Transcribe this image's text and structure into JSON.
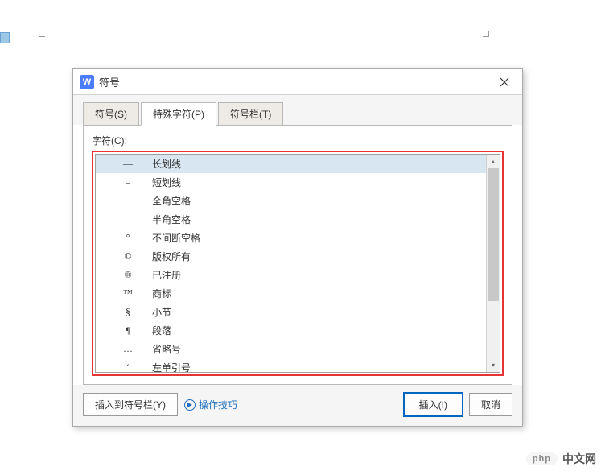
{
  "dialog": {
    "title": "符号",
    "app_logo": "W",
    "tabs": [
      {
        "label": "符号(S)"
      },
      {
        "label": "特殊字符(P)"
      },
      {
        "label": "符号栏(T)"
      }
    ],
    "field_label": "字符(C):",
    "characters": [
      {
        "symbol": "—",
        "name": "长划线"
      },
      {
        "symbol": "–",
        "name": "短划线"
      },
      {
        "symbol": "",
        "name": "全角空格"
      },
      {
        "symbol": "",
        "name": "半角空格"
      },
      {
        "symbol": "°",
        "name": "不间断空格"
      },
      {
        "symbol": "©",
        "name": "版权所有"
      },
      {
        "symbol": "®",
        "name": "已注册"
      },
      {
        "symbol": "™",
        "name": "商标"
      },
      {
        "symbol": "§",
        "name": "小节"
      },
      {
        "symbol": "¶",
        "name": "段落"
      },
      {
        "symbol": "…",
        "name": "省略号"
      },
      {
        "symbol": "‘",
        "name": "左单引号"
      }
    ],
    "buttons": {
      "insert_to_bar": "插入到符号栏(Y)",
      "tips": "操作技巧",
      "insert": "插入(I)",
      "cancel": "取消"
    }
  },
  "watermark": {
    "badge": "php",
    "text": "中文网"
  }
}
